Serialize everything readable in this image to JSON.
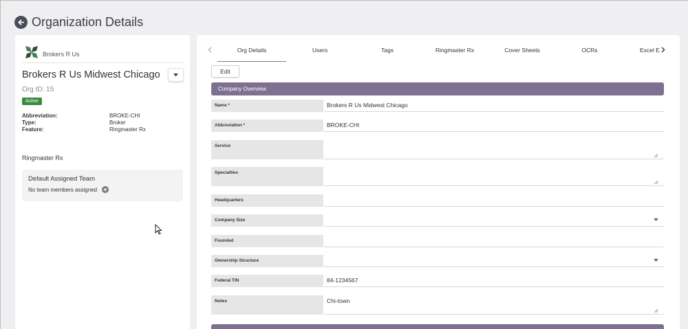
{
  "header": {
    "title": "Organization Details"
  },
  "org": {
    "logo_text": "Brokers R Us",
    "name": "Brokers R Us Midwest Chicago",
    "id_label": "Org ID: 15",
    "status": "Active",
    "info": [
      {
        "label": "Abbreviation:",
        "value": "BROKE-CHI"
      },
      {
        "label": "Type:",
        "value": "Broker"
      },
      {
        "label": "Feature:",
        "value": "Ringmaster Rx"
      }
    ],
    "product_section": "Ringmaster Rx",
    "team": {
      "title": "Default Assigned Team",
      "empty_text": "No team members assigned"
    }
  },
  "tabs": [
    "Org Details",
    "Users",
    "Tags",
    "Ringmaster Rx",
    "Cover Sheets",
    "OCRs",
    "Excel E"
  ],
  "active_tab": "Org Details",
  "edit_label": "Edit",
  "sections": {
    "company_overview": "Company Overview"
  },
  "form": {
    "name": {
      "label": "Name *",
      "value": "Brokers R Us Midwest Chicago"
    },
    "abbreviation": {
      "label": "Abbreviation *",
      "value": "BROKE-CHI"
    },
    "service": {
      "label": "Service",
      "value": ""
    },
    "specialties": {
      "label": "Specialties",
      "value": ""
    },
    "headquarters": {
      "label": "Headquarters",
      "value": ""
    },
    "company_size": {
      "label": "Company Size",
      "value": ""
    },
    "founded": {
      "label": "Founded",
      "value": ""
    },
    "ownership": {
      "label": "Ownership Structure",
      "value": ""
    },
    "federal_tin": {
      "label": "Federal TIN",
      "value": "84-1234567"
    },
    "notes": {
      "label": "Notes",
      "value": "Chi-town"
    }
  },
  "colors": {
    "section_header": "#7d7090",
    "status_active": "#3b8a3e",
    "label_bg": "#e6e6e6"
  }
}
